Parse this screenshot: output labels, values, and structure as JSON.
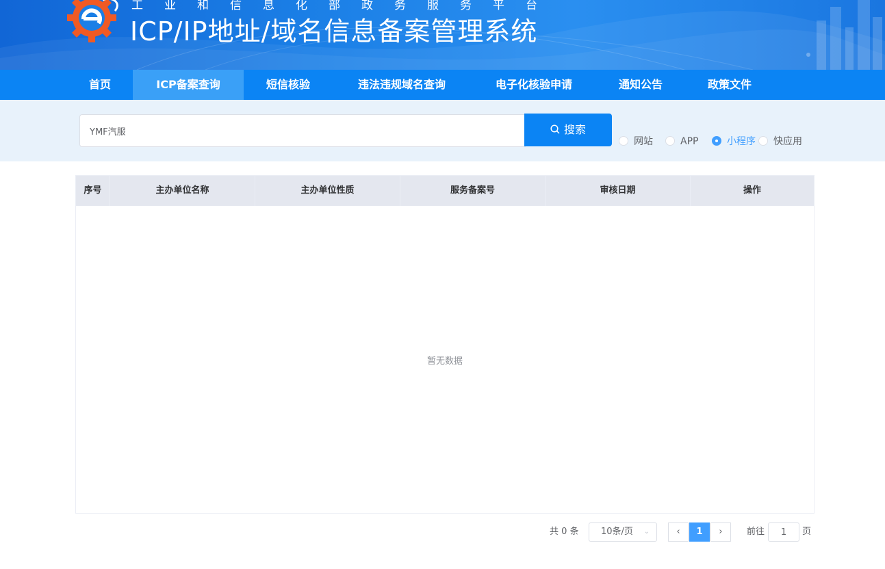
{
  "header": {
    "subtitle": "工业和信息化部政务服务平台",
    "title": "ICP/IP地址/域名信息备案管理系统"
  },
  "nav": {
    "items": [
      {
        "label": "首页"
      },
      {
        "label": "ICP备案查询"
      },
      {
        "label": "短信核验"
      },
      {
        "label": "违法违规域名查询"
      },
      {
        "label": "电子化核验申请"
      },
      {
        "label": "通知公告"
      },
      {
        "label": "政策文件"
      }
    ],
    "active": "ICP备案查询"
  },
  "search": {
    "value": "YMF汽服",
    "button_label": "搜索",
    "button_icon": "search-icon",
    "options": [
      {
        "label": "网站",
        "checked": false
      },
      {
        "label": "APP",
        "checked": false
      },
      {
        "label": "小程序",
        "checked": true
      },
      {
        "label": "快应用",
        "checked": false
      }
    ]
  },
  "table": {
    "columns": [
      "序号",
      "主办单位名称",
      "主办单位性质",
      "服务备案号",
      "审核日期",
      "操作"
    ],
    "rows": [],
    "empty_text": "暂无数据"
  },
  "pagination": {
    "total_text": "共 0 条",
    "page_size": "10条/页",
    "current_page": "1",
    "goto_prefix": "前往",
    "goto_value": "1",
    "goto_suffix": "页"
  },
  "colors": {
    "banner": "#1b7fe6",
    "nav": "#0b84f4",
    "nav_active": "#3aa0f7",
    "accent": "#409eff"
  }
}
